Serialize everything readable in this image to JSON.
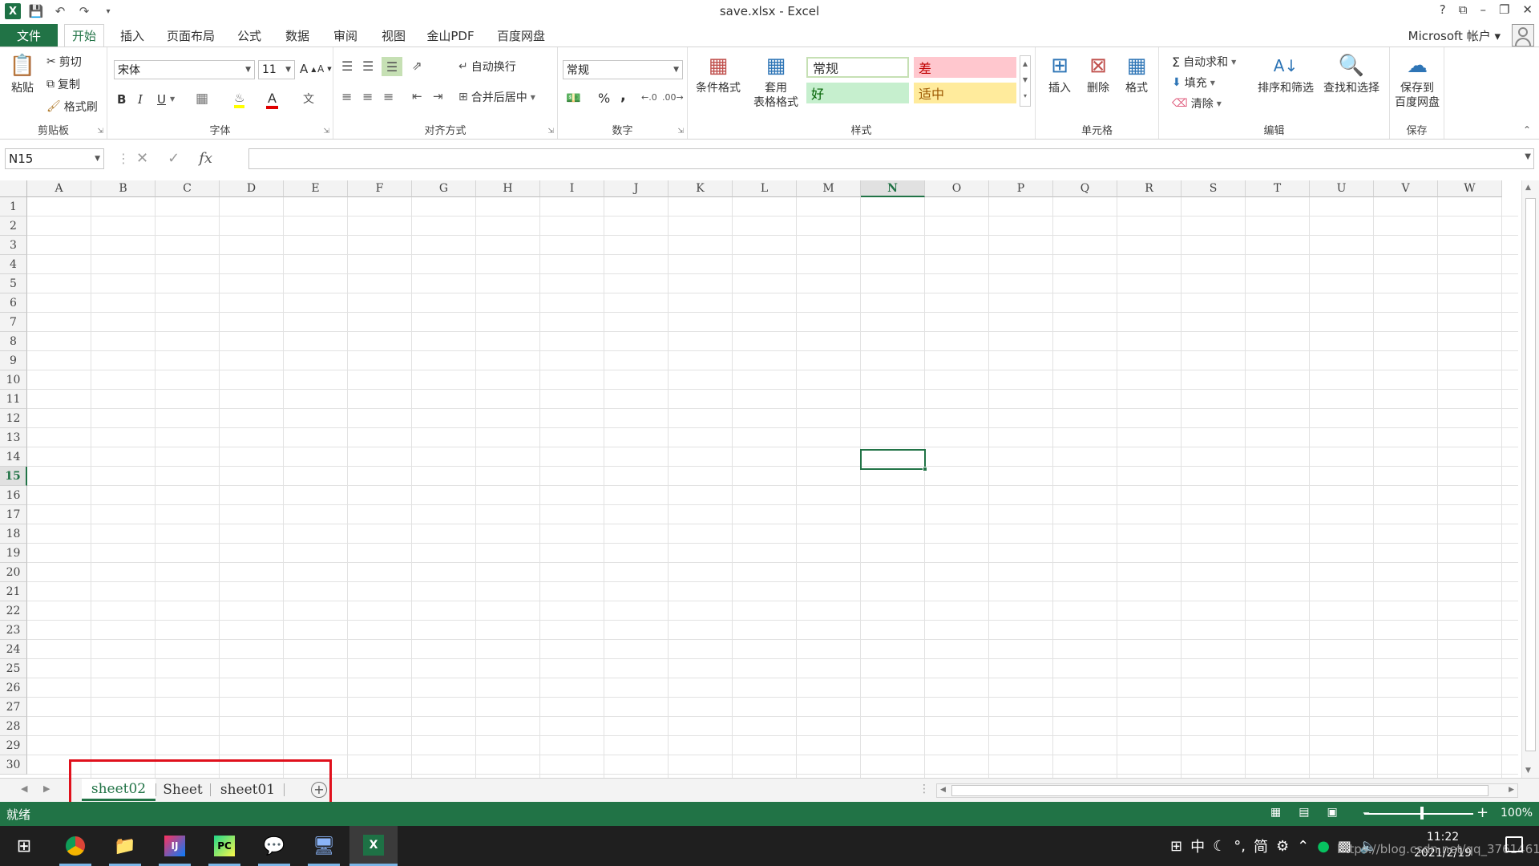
{
  "window": {
    "title": "save.xlsx - Excel",
    "controls": [
      "?",
      "⧉",
      "–",
      "❐",
      "✕"
    ],
    "account": "Microsoft 帐户 ▾"
  },
  "ribbon_tabs": [
    "文件",
    "开始",
    "插入",
    "页面布局",
    "公式",
    "数据",
    "审阅",
    "视图",
    "金山PDF",
    "百度网盘"
  ],
  "active_tab": "开始",
  "clipboard": {
    "paste": "粘贴",
    "cut": "剪切",
    "copy": "复制",
    "painter": "格式刷",
    "label": "剪贴板"
  },
  "font": {
    "name": "宋体",
    "size": "11",
    "grow": "A",
    "shrink": "A",
    "bold": "B",
    "italic": "I",
    "underline": "U",
    "label": "字体"
  },
  "alignment": {
    "wrap": "自动换行",
    "merge": "合并后居中",
    "label": "对齐方式"
  },
  "number": {
    "format": "常规",
    "percent": "%",
    "comma": ",",
    "label": "数字"
  },
  "styles": {
    "conditional": "条件格式",
    "table": "套用\n表格格式",
    "normal": "常规",
    "bad": "差",
    "good": "好",
    "neutral": "适中",
    "label": "样式",
    "colors": {
      "normal_bg": "#ffffff",
      "bad_bg": "#ffc7ce",
      "good_bg": "#c6efce",
      "neutral_bg": "#ffeb9c"
    }
  },
  "cells_group": {
    "insert": "插入",
    "delete": "删除",
    "format": "格式",
    "label": "单元格"
  },
  "editing": {
    "autosum": "自动求和",
    "fill": "填充",
    "clear": "清除",
    "sort": "排序和筛选",
    "find": "查找和选择",
    "label": "编辑"
  },
  "save_group": {
    "save": "保存到\n百度网盘",
    "label": "保存"
  },
  "formula_bar": {
    "name_box": "N15",
    "cancel": "✕",
    "enter": "✓",
    "fx": "fx",
    "content": ""
  },
  "columns": [
    "A",
    "B",
    "C",
    "D",
    "E",
    "F",
    "G",
    "H",
    "I",
    "J",
    "K",
    "L",
    "M",
    "N",
    "O",
    "P",
    "Q",
    "R",
    "S",
    "T",
    "U",
    "V",
    "W"
  ],
  "rows": [
    "1",
    "2",
    "3",
    "4",
    "5",
    "6",
    "7",
    "8",
    "9",
    "10",
    "11",
    "12",
    "13",
    "14",
    "15",
    "16",
    "17",
    "18",
    "19",
    "20",
    "21",
    "22",
    "23",
    "24",
    "25",
    "26",
    "27",
    "28",
    "29",
    "30"
  ],
  "active_column": "N",
  "active_row": "15",
  "sheets": [
    {
      "name": "sheet02",
      "active": true
    },
    {
      "name": "Sheet",
      "active": false
    },
    {
      "name": "sheet01",
      "active": false
    }
  ],
  "add_sheet": "+",
  "status": {
    "ready": "就绪",
    "zoom": "100%",
    "zoom_minus": "–",
    "zoom_plus": "+"
  },
  "taskbar": {
    "ime": "中",
    "tray_text": "简",
    "time": "11:22",
    "date": "2021/2/19",
    "watermark": "https://blog.csdn.net/qq_3761461"
  },
  "accent_color": "#217346"
}
